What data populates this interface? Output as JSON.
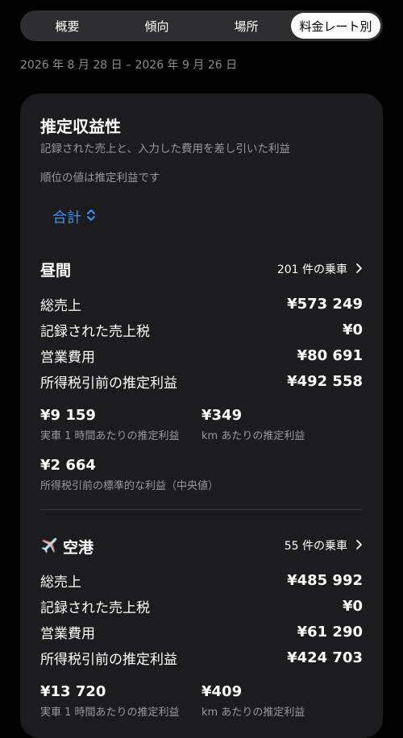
{
  "tabs": [
    {
      "label": "概要",
      "active": false
    },
    {
      "label": "傾向",
      "active": false
    },
    {
      "label": "場所",
      "active": false
    },
    {
      "label": "料金レート別",
      "active": true
    }
  ],
  "date_range": "2026 年 8 月 28 日 – 2026 年 9 月 26 日",
  "card": {
    "title": "推定収益性",
    "subtitle": "記録された売上と、入力した費用を差し引いた利益",
    "rank_note": "順位の値は推定利益です",
    "selector_label": "合計",
    "accent_color": "#3a8ef6"
  },
  "sections": [
    {
      "title": "昼間",
      "icon": "",
      "link": "201 件の乗車",
      "rows": [
        {
          "label": "総売上",
          "value": "¥573 249"
        },
        {
          "label": "記録された売上税",
          "value": "¥0"
        },
        {
          "label": "営業費用",
          "value": "¥80 691"
        },
        {
          "label": "所得税引前の推定利益",
          "value": "¥492 558"
        }
      ],
      "metrics": [
        {
          "value": "¥9 159",
          "label": "実車 1 時間あたりの推定利益"
        },
        {
          "value": "¥349",
          "label": "km あたりの推定利益"
        }
      ],
      "median": {
        "value": "¥2 664",
        "label": "所得税引前の標準的な利益（中央値）"
      }
    },
    {
      "title": "空港",
      "icon": "airplane-icon",
      "link": "55 件の乗車",
      "rows": [
        {
          "label": "総売上",
          "value": "¥485 992"
        },
        {
          "label": "記録された売上税",
          "value": "¥0"
        },
        {
          "label": "営業費用",
          "value": "¥61 290"
        },
        {
          "label": "所得税引前の推定利益",
          "value": "¥424 703"
        }
      ],
      "metrics": [
        {
          "value": "¥13 720",
          "label": "実車 1 時間あたりの推定利益"
        },
        {
          "value": "¥409",
          "label": "km あたりの推定利益"
        }
      ]
    }
  ]
}
